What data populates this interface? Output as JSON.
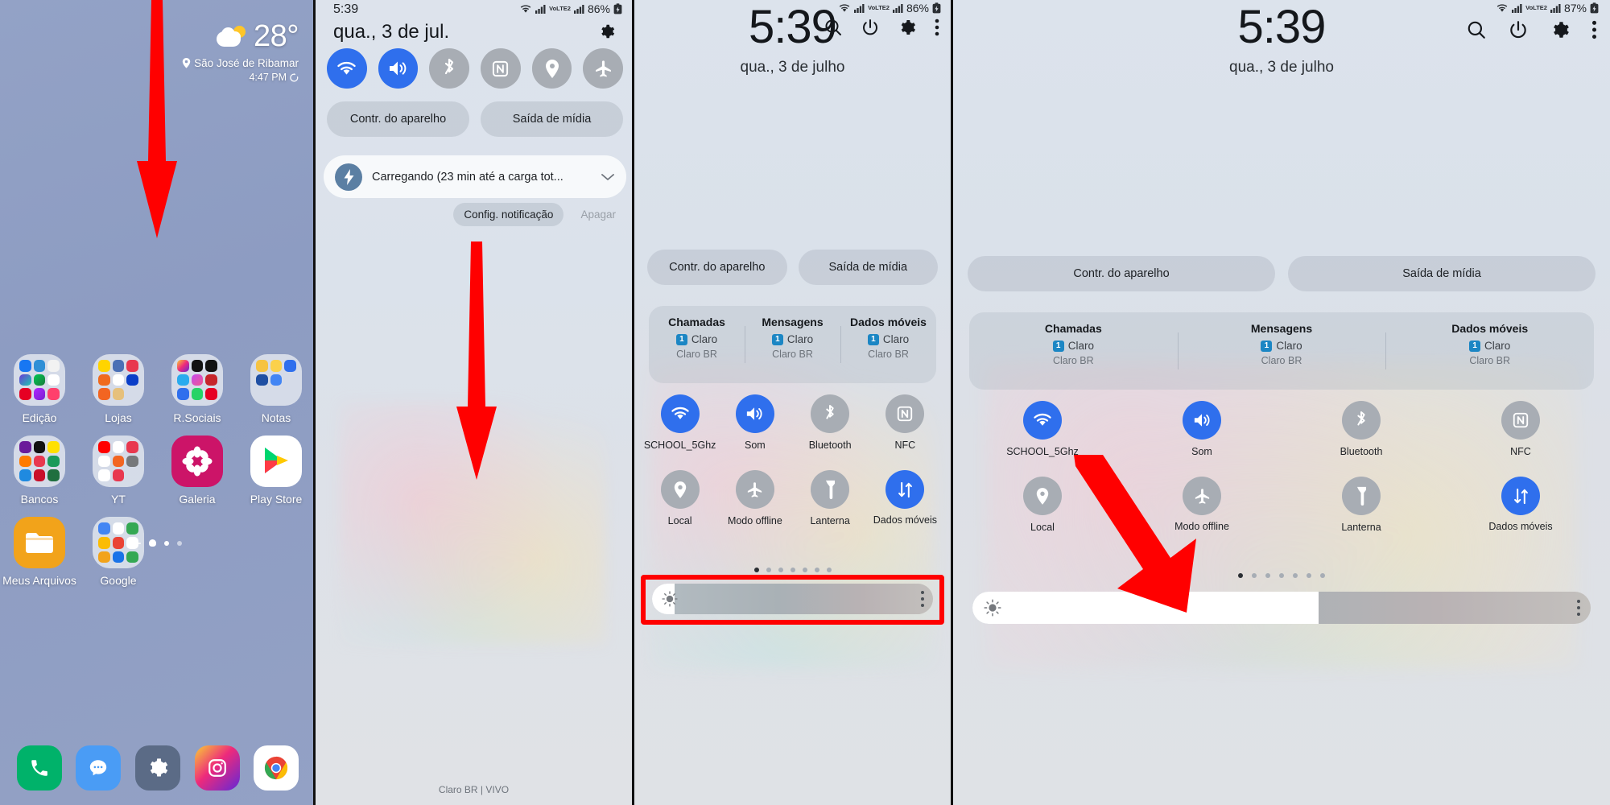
{
  "panel1": {
    "weather": {
      "icon": "partly-cloudy-icon",
      "temperature": "28°",
      "location": "São José de Ribamar",
      "location_icon": "location-pin-icon",
      "time": "4:47 PM",
      "refresh_icon": "refresh-icon"
    },
    "apps_row1": [
      {
        "label": "Edição",
        "type": "folder"
      },
      {
        "label": "Lojas",
        "type": "folder"
      },
      {
        "label": "R.Sociais",
        "type": "folder"
      },
      {
        "label": "Notas",
        "type": "folder"
      },
      {
        "label": "Bancos",
        "type": "folder"
      }
    ],
    "apps_row2": [
      {
        "label": "YT",
        "type": "folder"
      },
      {
        "label": "Galeria",
        "type": "app"
      },
      {
        "label": "Play Store",
        "type": "app"
      },
      {
        "label": "Meus Arquivos",
        "type": "app"
      },
      {
        "label": "Google",
        "type": "folder"
      }
    ],
    "dock": [
      {
        "name": "phone-app-icon"
      },
      {
        "name": "messages-app-icon"
      },
      {
        "name": "settings-app-icon"
      },
      {
        "name": "instagram-app-icon"
      },
      {
        "name": "chrome-app-icon"
      }
    ],
    "page_indicator": {
      "pages": 5,
      "active": 2
    }
  },
  "panel2": {
    "statusbar": {
      "time": "5:39",
      "wifi_icon": "wifi-icon",
      "signal_icon": "signal-bars-icon",
      "volte_label": "VoLTE2",
      "battery": "86%",
      "battery_icon": "battery-charging-icon"
    },
    "date": "qua., 3 de jul.",
    "settings_icon": "gear-icon",
    "toggles": [
      {
        "name": "wifi-toggle",
        "icon": "wifi-icon",
        "state": "on"
      },
      {
        "name": "sound-toggle",
        "icon": "speaker-icon",
        "state": "on"
      },
      {
        "name": "bluetooth-toggle",
        "icon": "bluetooth-icon",
        "state": "off"
      },
      {
        "name": "nfc-toggle",
        "icon": "nfc-icon",
        "state": "off"
      },
      {
        "name": "location-toggle",
        "icon": "location-pin-icon",
        "state": "off"
      },
      {
        "name": "airplane-toggle",
        "icon": "airplane-icon",
        "state": "off"
      }
    ],
    "pills": [
      "Contr. do aparelho",
      "Saída de mídia"
    ],
    "notification": {
      "icon": "charging-bolt-icon",
      "text": "Carregando (23 min até a carga tot...",
      "expand_icon": "chevron-down-icon"
    },
    "notification_actions": [
      {
        "label": "Config. notificação",
        "enabled": true
      },
      {
        "label": "Apagar",
        "enabled": false
      }
    ],
    "carrier": "Claro BR | VIVO"
  },
  "panel3": {
    "statusbar": {
      "wifi_icon": "wifi-icon",
      "signal_icon": "signal-bars-icon",
      "volte_label": "VoLTE2",
      "battery": "86%",
      "battery_icon": "battery-charging-icon"
    },
    "header_icons": [
      {
        "name": "search-icon"
      },
      {
        "name": "power-icon"
      },
      {
        "name": "gear-icon"
      },
      {
        "name": "more-vertical-icon"
      }
    ],
    "clock": {
      "time": "5:39",
      "date": "qua., 3 de julho"
    },
    "pills": [
      "Contr. do aparelho",
      "Saída de mídia"
    ],
    "sim": [
      {
        "title": "Chamadas",
        "badge": "1",
        "carrier": "Claro",
        "network": "Claro BR"
      },
      {
        "title": "Mensagens",
        "badge": "1",
        "carrier": "Claro",
        "network": "Claro BR"
      },
      {
        "title": "Dados móveis",
        "badge": "1",
        "carrier": "Claro",
        "network": "Claro BR"
      }
    ],
    "toggles": [
      {
        "label": "SCHOOL_5Ghz",
        "icon": "wifi-icon",
        "state": "on"
      },
      {
        "label": "Som",
        "icon": "speaker-icon",
        "state": "on"
      },
      {
        "label": "Bluetooth",
        "icon": "bluetooth-icon",
        "state": "off"
      },
      {
        "label": "NFC",
        "icon": "nfc-icon",
        "state": "off"
      },
      {
        "label": "Local",
        "icon": "location-pin-icon",
        "state": "off"
      },
      {
        "label": "Modo offline",
        "icon": "airplane-icon",
        "state": "off"
      },
      {
        "label": "Lanterna",
        "icon": "flashlight-icon",
        "state": "off"
      },
      {
        "label": "Dados móveis",
        "icon": "data-arrows-icon",
        "state": "on"
      }
    ],
    "page_indicator": {
      "pages": 7,
      "active": 1
    },
    "brightness": {
      "icon": "brightness-sun-icon",
      "value_percent": 8,
      "menu_icon": "more-vertical-icon"
    }
  },
  "panel4": {
    "statusbar": {
      "wifi_icon": "wifi-icon",
      "signal_icon": "signal-bars-icon",
      "volte_label": "VoLTE2",
      "battery": "87%",
      "battery_icon": "battery-charging-icon"
    },
    "header_icons": [
      {
        "name": "search-icon"
      },
      {
        "name": "power-icon"
      },
      {
        "name": "gear-icon"
      },
      {
        "name": "more-vertical-icon"
      }
    ],
    "clock": {
      "time": "5:39",
      "date": "qua., 3 de julho"
    },
    "pills": [
      "Contr. do aparelho",
      "Saída de mídia"
    ],
    "sim": [
      {
        "title": "Chamadas",
        "badge": "1",
        "carrier": "Claro",
        "network": "Claro BR"
      },
      {
        "title": "Mensagens",
        "badge": "1",
        "carrier": "Claro",
        "network": "Claro BR"
      },
      {
        "title": "Dados móveis",
        "badge": "1",
        "carrier": "Claro",
        "network": "Claro BR"
      }
    ],
    "toggles": [
      {
        "label": "SCHOOL_5Ghz",
        "icon": "wifi-icon",
        "state": "on"
      },
      {
        "label": "Som",
        "icon": "speaker-icon",
        "state": "on"
      },
      {
        "label": "Bluetooth",
        "icon": "bluetooth-icon",
        "state": "off"
      },
      {
        "label": "NFC",
        "icon": "nfc-icon",
        "state": "off"
      },
      {
        "label": "Local",
        "icon": "location-pin-icon",
        "state": "off"
      },
      {
        "label": "Modo offline",
        "icon": "airplane-icon",
        "state": "off"
      },
      {
        "label": "Lanterna",
        "icon": "flashlight-icon",
        "state": "off"
      },
      {
        "label": "Dados móveis",
        "icon": "data-arrows-icon",
        "state": "on"
      }
    ],
    "page_indicator": {
      "pages": 7,
      "active": 1
    },
    "brightness": {
      "icon": "brightness-sun-icon",
      "value_percent": 56,
      "menu_icon": "more-vertical-icon"
    }
  },
  "annotations": {
    "arrow_color": "#ff0000",
    "arrows": [
      {
        "name": "swipe-down-arrow-home"
      },
      {
        "name": "swipe-down-arrow-shade"
      },
      {
        "name": "pointer-arrow-brightness"
      }
    ],
    "highlight_color": "#ff0000",
    "highlights": [
      {
        "name": "brightness-slider-highlight"
      }
    ]
  },
  "colors": {
    "accent_blue": "#2f6fed",
    "toggle_off_gray": "#a8adb4",
    "sim_badge_blue": "#1b86c4",
    "annotation_red": "#ff0000",
    "home_wallpaper": "#8d9cc2"
  }
}
